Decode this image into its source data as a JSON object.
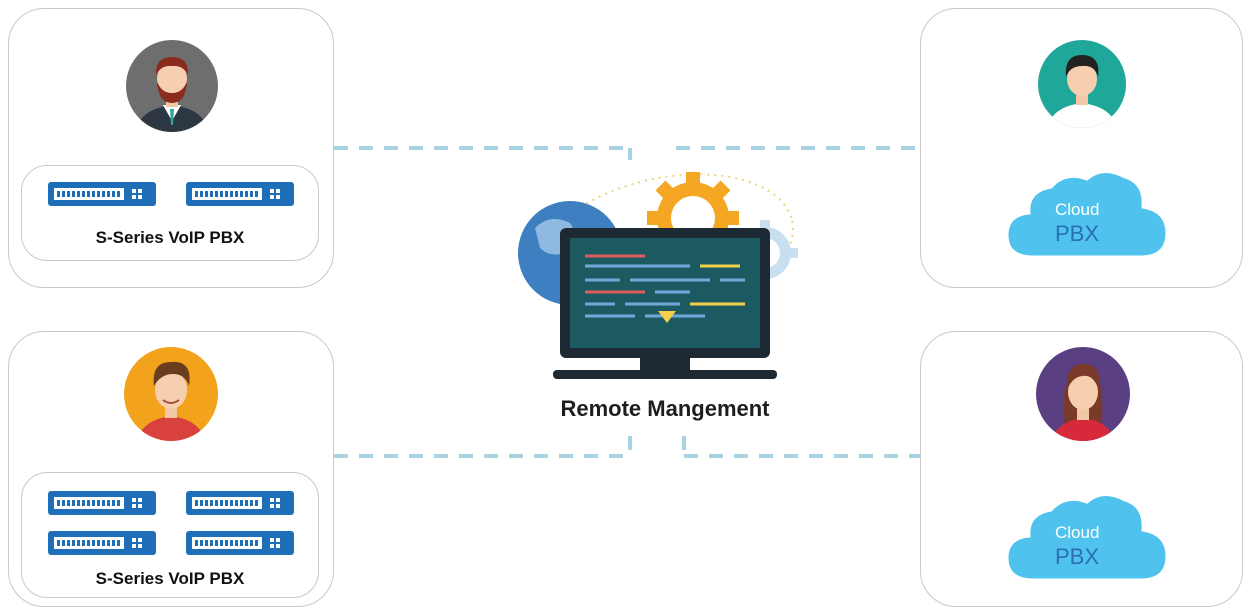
{
  "center": {
    "label": "Remote Mangement"
  },
  "left_top": {
    "device_label": "S-Series VoIP PBX"
  },
  "left_bottom": {
    "device_label": "S-Series VoIP PBX"
  },
  "right_top": {
    "cloud_line1": "Cloud",
    "cloud_line2": "PBX"
  },
  "right_bottom": {
    "cloud_line1": "Cloud",
    "cloud_line2": "PBX"
  },
  "colors": {
    "dash": "#a8d3e0",
    "card_border": "#c9c9c9",
    "switch_blue": "#1f6fb8",
    "cloud_blue": "#4fc3ee",
    "gear_orange": "#f5a623"
  }
}
